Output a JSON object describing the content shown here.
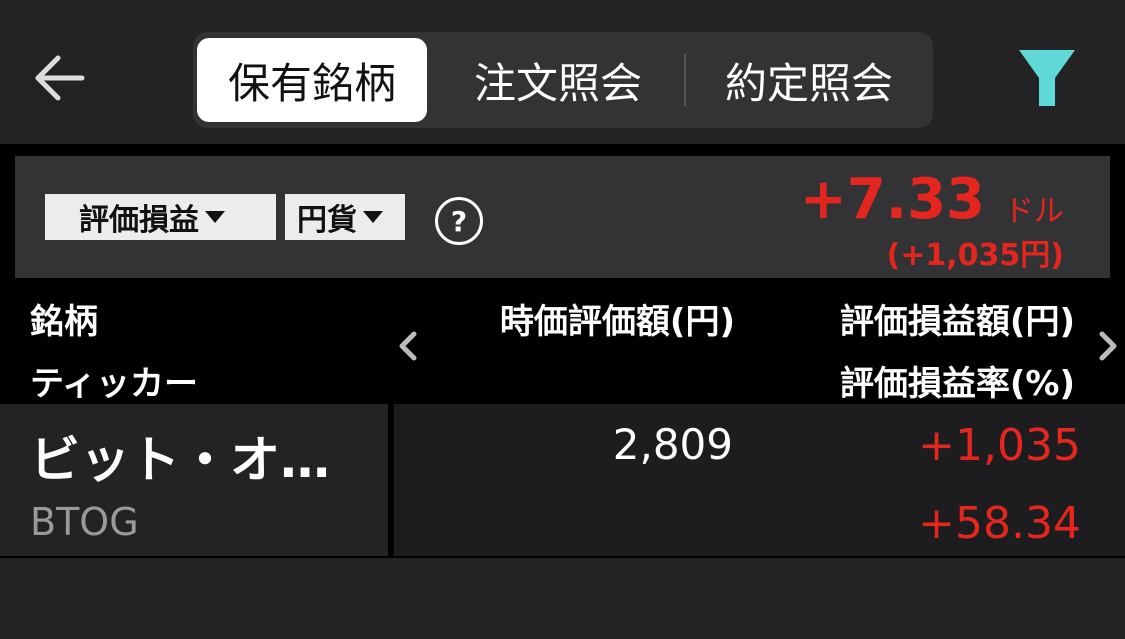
{
  "header": {
    "back_icon": "arrow-left-icon",
    "tabs": [
      {
        "label": "保有銘柄",
        "active": true
      },
      {
        "label": "注文照会",
        "active": false
      },
      {
        "label": "約定照会",
        "active": false
      }
    ],
    "filter_icon": "filter-icon",
    "filter_color": "#5fd8d8"
  },
  "summary": {
    "metric_dropdown": "評価損益",
    "currency_dropdown": "円貨",
    "help_label": "?",
    "pl_value": "+7.33",
    "pl_unit": "ドル",
    "pl_sub": "(+1,035円)",
    "loss_gain_color": "#e5261f"
  },
  "columns": {
    "name": "銘柄",
    "ticker": "ティッカー",
    "market_value": "時価評価額(円)",
    "pl_amount": "評価損益額(円)",
    "pl_rate": "評価損益率(%)"
  },
  "holdings": [
    {
      "name": "ビット・オ…",
      "ticker": "BTOG",
      "market_value": "2,809",
      "pl_amount": "+1,035",
      "pl_rate": "+58.34"
    }
  ]
}
